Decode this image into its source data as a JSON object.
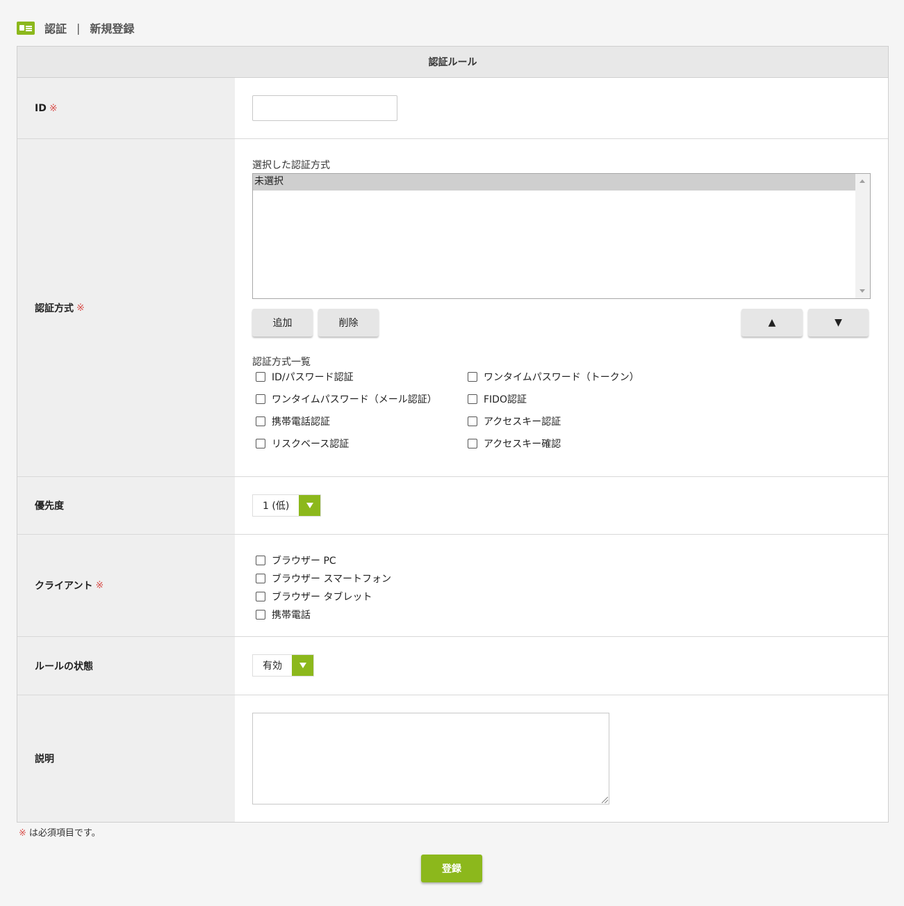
{
  "header": {
    "section": "認証",
    "separator": "|",
    "page": "新規登録"
  },
  "table_title": "認証ルール",
  "required_mark": "※",
  "fields": {
    "id": {
      "label": "ID",
      "value": ""
    },
    "auth_method": {
      "label": "認証方式",
      "selected_label": "選択した認証方式",
      "selected_items": [
        "未選択"
      ],
      "add_label": "追加",
      "delete_label": "削除",
      "up_label": "▲",
      "down_label": "▼",
      "list_title": "認証方式一覧",
      "options": [
        "ID/パスワード認証",
        "ワンタイムパスワード（トークン）",
        "ワンタイムパスワード（メール認証）",
        "FIDO認証",
        "携帯電話認証",
        "アクセスキー認証",
        "リスクベース認証",
        "アクセスキー確認"
      ]
    },
    "priority": {
      "label": "優先度",
      "value": "1 (低)"
    },
    "client": {
      "label": "クライアント",
      "options": [
        "ブラウザー PC",
        "ブラウザー スマートフォン",
        "ブラウザー タブレット",
        "携帯電話"
      ]
    },
    "rule_state": {
      "label": "ルールの状態",
      "value": "有効"
    },
    "description": {
      "label": "説明",
      "value": ""
    }
  },
  "note": "は必須項目です。",
  "submit_label": "登録",
  "colors": {
    "accent": "#8cb81c",
    "required": "#d9534f"
  }
}
